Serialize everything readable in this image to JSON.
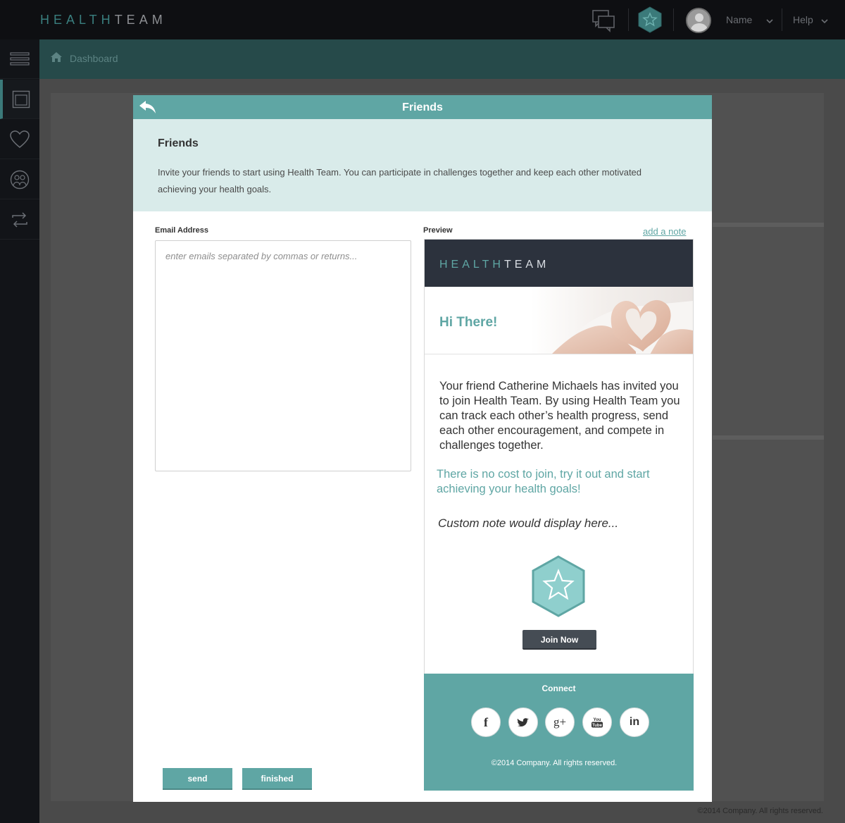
{
  "app": {
    "logo_part1": "HEALTH",
    "logo_part2": "TEAM"
  },
  "topbar": {
    "user_name": "Name",
    "help_label": "Help"
  },
  "breadcrumb": {
    "home_label": "Dashboard"
  },
  "sidebar": {
    "items": [
      {
        "icon": "menu-icon"
      },
      {
        "icon": "window-icon",
        "active": true
      },
      {
        "icon": "heart-icon"
      },
      {
        "icon": "people-icon"
      },
      {
        "icon": "swap-icon"
      }
    ]
  },
  "modal": {
    "header_title": "Friends",
    "intro_title": "Friends",
    "intro_text": "Invite your friends to start using Health Team. You can participate in challenges together and keep each other motivated achieving your health goals.",
    "email_label": "Email Address",
    "email_placeholder": "enter emails separated by commas or returns...",
    "email_value": "",
    "send_label": "send",
    "finished_label": "finished",
    "preview_label": "Preview",
    "add_note_label": "add a note"
  },
  "preview": {
    "logo_part1": "HEALTH",
    "logo_part2": "TEAM",
    "greeting": "Hi There!",
    "body": "Your friend Catherine Michaels has invited you to join Health Team. By using Health Team you can track each other’s health progress, send each other encouragement, and compete in challenges together.",
    "cost_text": "There is no cost to join, try it out and start achieving your health goals!",
    "custom_note": "Custom note would display here...",
    "join_label": "Join Now",
    "connect_label": "Connect",
    "social": [
      "f",
      "twitter",
      "g+",
      "YouTube",
      "in"
    ],
    "copyright": "©2014 Company. All rights reserved."
  },
  "page_footer": "©2014 Company. All rights reserved.",
  "colors": {
    "accent": "#5fa6a4",
    "topbar": "#0e0f12",
    "crumbbar": "#264a4a",
    "email_header": "#2c323d"
  }
}
